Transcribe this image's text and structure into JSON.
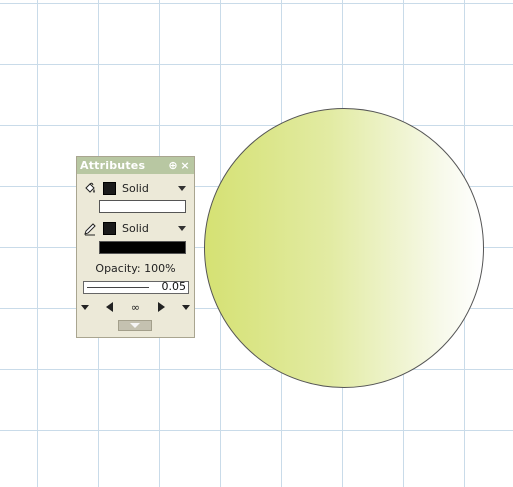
{
  "panel": {
    "title": "Attributes",
    "pin_glyph": "⊕",
    "close_glyph": "×"
  },
  "fill": {
    "icon": "paint-bucket-icon",
    "style": "Solid",
    "swatch_color": "#1a1a1a",
    "color_bar": "#ffffff"
  },
  "stroke": {
    "icon": "pencil-icon",
    "style": "Solid",
    "swatch_color": "#1a1a1a",
    "color_bar": "#000000"
  },
  "opacity": {
    "label": "Opacity: 100%"
  },
  "stroke_weight": {
    "value": "0.05"
  },
  "nav": {
    "link_glyph": "∞"
  },
  "shape": {
    "type": "circle",
    "fill_gradient": [
      "#d5e173",
      "#e2eba3",
      "#f7f9ea",
      "#ffffff"
    ],
    "stroke_color": "#555555"
  },
  "canvas": {
    "grid_color": "#c9dbe9",
    "background": "#ffffff"
  }
}
